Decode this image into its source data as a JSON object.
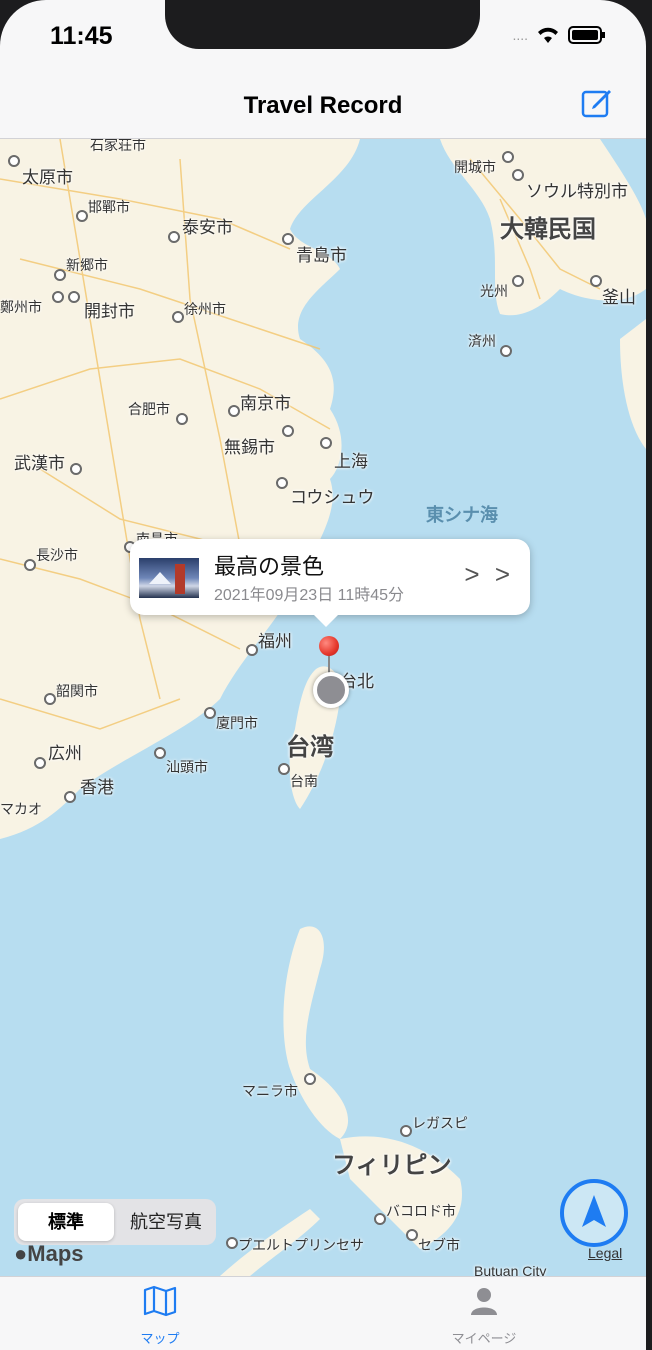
{
  "status": {
    "time": "11:45"
  },
  "nav": {
    "title": "Travel Record",
    "compose_icon": "compose-icon"
  },
  "map": {
    "labels": {
      "shijiazhuang": "石家荘市",
      "taiyuan": "太原市",
      "handan": "邯鄲市",
      "taian": "泰安市",
      "qingdao": "青島市",
      "xinxiang": "新郷市",
      "zhengzhou": "鄭州市",
      "kaifeng": "開封市",
      "xuzhou": "徐州市",
      "hefei": "合肥市",
      "nanjing": "南京市",
      "wuxi": "無錫市",
      "shanghai": "上海",
      "suzhou": "コウシュウ",
      "wuhan": "武漢市",
      "changsha": "長沙市",
      "nanchang": "南昌市",
      "fuzhou": "福州",
      "taipei": "台北",
      "shaoguan": "韶関市",
      "xiamen": "廈門市",
      "taiwan": "台湾",
      "guangzhou": "広州",
      "shantou": "汕頭市",
      "tainan": "台南",
      "hongkong": "香港",
      "macau": "マカオ",
      "kaesong": "開城市",
      "seoul": "ソウル特別市",
      "korea": "大韓民国",
      "gwangju": "光州",
      "busan": "釜山",
      "jeju": "済州",
      "east_china_sea": "東シナ海",
      "manila": "マニラ市",
      "legazpi": "レガスピ",
      "philippines": "フィリピン",
      "bacolod": "バコロド市",
      "cebu": "セブ市",
      "puerto_princesa": "プエルトプリンセサ",
      "butuan": "Butuan City"
    },
    "callout": {
      "title": "最高の景色",
      "subtitle": "2021年09月23日 11時45分",
      "arrow": "> >"
    },
    "segment": {
      "standard": "標準",
      "satellite": "航空写真"
    },
    "maps_logo": "Maps",
    "legal": "Legal"
  },
  "tabs": [
    {
      "label": "マップ",
      "icon": "map-icon",
      "active": true
    },
    {
      "label": "マイページ",
      "icon": "person-icon",
      "active": false
    }
  ],
  "colors": {
    "accent": "#1e7cf2",
    "water": "#b7ddf0",
    "land": "#f8f3e4",
    "roads": "#f3c56b"
  }
}
